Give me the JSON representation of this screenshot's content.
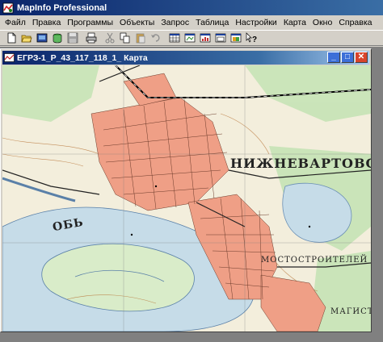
{
  "app": {
    "title": "MapInfo Professional"
  },
  "menu": {
    "items": [
      "Файл",
      "Правка",
      "Программы",
      "Объекты",
      "Запрос",
      "Таблица",
      "Настройки",
      "Карта",
      "Окно",
      "Справка"
    ]
  },
  "toolbar": {
    "buttons": [
      {
        "name": "new-icon"
      },
      {
        "name": "open-icon"
      },
      {
        "name": "open-workspace-icon"
      },
      {
        "name": "open-dbms-icon"
      },
      {
        "name": "save-icon"
      },
      {
        "name": "print-icon"
      },
      {
        "name": "cut-icon"
      },
      {
        "name": "copy-icon"
      },
      {
        "name": "paste-icon"
      },
      {
        "name": "undo-icon"
      },
      {
        "name": "new-browser-icon"
      },
      {
        "name": "new-mapper-icon"
      },
      {
        "name": "new-grapher-icon"
      },
      {
        "name": "new-layout-icon"
      },
      {
        "name": "new-redistrict-icon"
      },
      {
        "name": "help-icon"
      }
    ]
  },
  "document_window": {
    "title": "ЕГРЗ-1_P_43_117_118_1_ Карта",
    "buttons": {
      "minimize": "_",
      "maximize": "□",
      "close": "✕"
    }
  },
  "map": {
    "labels": {
      "city": "НИЖНЕВАРТОВСК",
      "river": "ОБЬ",
      "district1": "МОСТОСТРОИТЕЛЕЙ",
      "district2": "МАГИСТР"
    },
    "colors": {
      "water": "#c6dce8",
      "urban": "#ef9f86",
      "land": "#f3eedc",
      "forest": "#bfe0b0",
      "contour": "#b8763a",
      "road": "#222222"
    }
  }
}
